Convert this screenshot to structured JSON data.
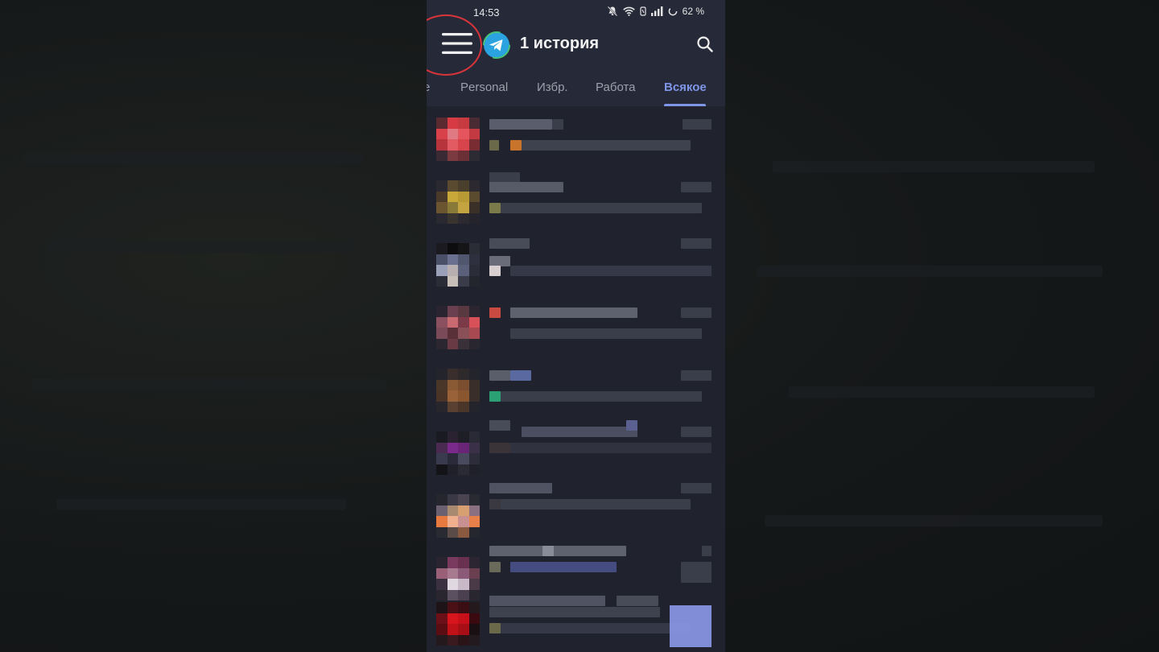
{
  "status_bar": {
    "time": "14:53",
    "battery": "62 %"
  },
  "header": {
    "title": "1 история"
  },
  "tabs": [
    {
      "label": "е",
      "active": false
    },
    {
      "label": "Personal",
      "active": false
    },
    {
      "label": "Избр.",
      "active": false
    },
    {
      "label": "Работа",
      "active": false
    },
    {
      "label": "Всякое",
      "active": true
    }
  ],
  "colors": {
    "accent": "#7e95e8",
    "highlight_ring": "#d9343a",
    "appbar": "#262a38",
    "list_bg": "#20222e",
    "logo": "#2aa3e0"
  },
  "icons": {
    "menu": "hamburger-icon",
    "logo": "telegram-logo-icon",
    "search": "search-icon"
  },
  "chat_avatars": [
    [
      "#5a2a30",
      "#d83a44",
      "#c73a40",
      "#4a2a33",
      "#d8414a",
      "#e07a82",
      "#e5555d",
      "#c43a42",
      "#b8343c",
      "#e25b62",
      "#d8444b",
      "#7a2c33",
      "#3a2a33",
      "#7a3a40",
      "#6a3035",
      "#2c2a33"
    ],
    [
      "#2a2830",
      "#5a4a30",
      "#4a3f2c",
      "#2c2a30",
      "#4a3a2a",
      "#c8a838",
      "#b89a34",
      "#5a4a2e",
      "#6a5530",
      "#8a7a3a",
      "#c4a440",
      "#3a3028",
      "#2a2830",
      "#3a3430",
      "#2c2a30",
      "#25242c"
    ],
    [
      "#1a1a20",
      "#0d0d10",
      "#151518",
      "#2a2c36",
      "#4a5068",
      "#6a7090",
      "#50566e",
      "#2e3040",
      "#9aa0b8",
      "#b8b0b0",
      "#5a607a",
      "#2a2c38",
      "#2a2c36",
      "#c8c0b8",
      "#3a3c4a",
      "#24262e"
    ],
    [
      "#2a2430",
      "#6a4050",
      "#5a3840",
      "#2c2630",
      "#8a5060",
      "#c86a70",
      "#7a3a48",
      "#d85058",
      "#7a4a58",
      "#5a3038",
      "#8a5058",
      "#a84850",
      "#2c2630",
      "#6a3a44",
      "#3a3038",
      "#2a2630"
    ],
    [
      "#24242c",
      "#3a2e2c",
      "#2e2a2c",
      "#24242c",
      "#4a3628",
      "#8a5a34",
      "#7a4e2e",
      "#3a2e2a",
      "#4a3428",
      "#9a6238",
      "#8a5630",
      "#3a2e2a",
      "#26262c",
      "#5a4030",
      "#4a3628",
      "#24242c"
    ],
    [
      "#1a1a22",
      "#2a2230",
      "#1e1e26",
      "#2a2a36",
      "#4a2a50",
      "#7a2a8a",
      "#6a2478",
      "#3a3048",
      "#3a3a4e",
      "#2a2a3a",
      "#4a4a5e",
      "#2c2c3a",
      "#141418",
      "#20202a",
      "#2a2a34",
      "#20202a"
    ],
    [
      "#26262e",
      "#3a3844",
      "#4a4450",
      "#2a2a32",
      "#6a6070",
      "#a88a70",
      "#d8a070",
      "#8a7080",
      "#e87a40",
      "#f0b090",
      "#c89090",
      "#e8804a",
      "#2a2a32",
      "#5a4a48",
      "#8a5a40",
      "#26262e"
    ],
    [
      "#2a2430",
      "#7a3a60",
      "#6a3050",
      "#2c2632",
      "#9a6078",
      "#a87a90",
      "#8a5a78",
      "#6a4050",
      "#3a3040",
      "#e0d8e0",
      "#c8b8c8",
      "#4a3a48",
      "#2a2630",
      "#5a5060",
      "#4a4050",
      "#2a2630"
    ],
    [
      "#1e1418",
      "#4a1016",
      "#3a0e12",
      "#241a1e",
      "#6a1016",
      "#d8141c",
      "#c8101a",
      "#3a0a10",
      "#5a0e14",
      "#c01018",
      "#a80e16",
      "#1a1014",
      "#241a1e",
      "#3a1a1e",
      "#2a1418",
      "#221a1e"
    ]
  ]
}
